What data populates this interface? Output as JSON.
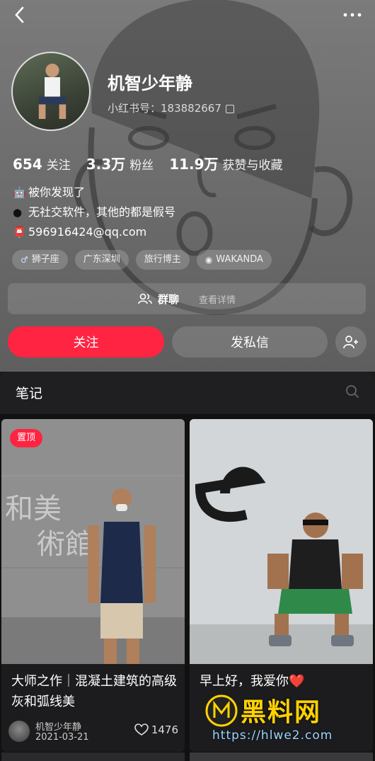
{
  "nav": {
    "back_icon": "chevron-left-icon",
    "more_icon": "more-dots-icon"
  },
  "profile": {
    "name": "机智少年静",
    "red_id": "小红书号：183882667",
    "stats": [
      {
        "num": "654",
        "label": "关注"
      },
      {
        "num": "3.3万",
        "label": "粉丝"
      },
      {
        "num": "11.9万",
        "label": "获赞与收藏"
      }
    ],
    "bio": [
      {
        "icon": "🤖",
        "text": "被你发现了"
      },
      {
        "icon": "●",
        "text": "无社交软件，其他的都是假号"
      },
      {
        "icon": "📮",
        "text": "596916424@qq.com"
      }
    ],
    "tags": [
      {
        "icon": "♂",
        "text": "狮子座"
      },
      {
        "icon": "",
        "text": "广东深圳"
      },
      {
        "icon": "",
        "text": "旅行博主"
      },
      {
        "icon": "◉",
        "text": "WAKANDA"
      }
    ]
  },
  "group": {
    "title": "群聊",
    "sub": "查看详情"
  },
  "actions": {
    "follow": "关注",
    "message": "发私信",
    "add_icon": "add-user-icon"
  },
  "notes": {
    "title": "笔记",
    "cards": [
      {
        "pin": "置顶",
        "title": "大师之作｜混凝土建筑的高级灰和弧线美",
        "author": "机智少年静",
        "date": "2021-03-21",
        "likes": "1476"
      },
      {
        "title": "早上好，我爱你❤️"
      }
    ]
  },
  "watermark": {
    "main": "黑料网",
    "url": "https://hlwe2.com"
  },
  "colors": {
    "accent": "#ff2442",
    "header_bg": "#6f6f6f",
    "page_bg": "#1a1a1a"
  }
}
